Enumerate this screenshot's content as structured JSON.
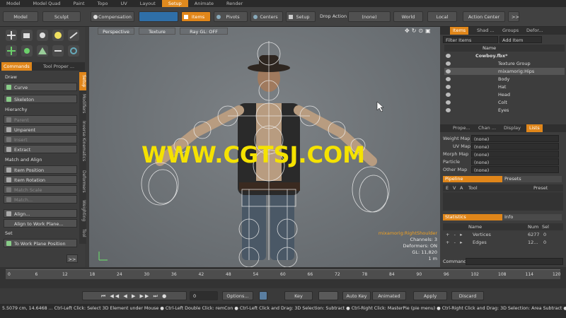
{
  "top_tabs": [
    "Model",
    "Model Quad",
    "Paint",
    "Topo",
    "UV",
    "Layout",
    "Setup",
    "Animate",
    "Render"
  ],
  "active_top_tab": "Setup",
  "toolbar": {
    "model": "Model",
    "sculpt": "Sculpt",
    "compensation": "Compensation",
    "items": "Items",
    "pivots": "Pivots",
    "centers": "Centers",
    "setup": "Setup",
    "drop_action_label": "Drop Action",
    "drop_action_value": "(none)",
    "world": "World",
    "local": "Local",
    "action_center": "Action Center",
    "more": ">>"
  },
  "left_tabs": {
    "commands": "Commands",
    "tool_properties": "Tool Proper ..."
  },
  "left_sections": {
    "draw": "Draw",
    "curve": "Curve",
    "skeleton": "Skeleton",
    "hierarchy": "Hierarchy",
    "parent": "Parent",
    "unparent": "Unparent",
    "insert": "Insert",
    "extract": "Extract",
    "match_align": "Match and Align",
    "item_position": "Item Position",
    "item_rotation": "Item Rotation",
    "match_scale": "Match Scale",
    "match": "Match...",
    "align": "Align...",
    "align_work_plane": "Align to Work Plane...",
    "set": "Set",
    "to_work_plane": "To Work Plane Position",
    "more": ">>"
  },
  "vertical_tabs": [
    "Setup",
    "Modifiers",
    "Inverse Kinematics",
    "Deformers",
    "Weighting",
    "Tool"
  ],
  "viewport": {
    "perspective": "Perspective",
    "texture": "Texture",
    "ray_gl": "Ray GL: OFF",
    "watermark": "WWW.CGTSJ.COM",
    "info_item": "mixamorig:RightShoulder",
    "info_channels": "Channels: 3",
    "info_deformers": "Deformers: ON",
    "info_gl": "GL: 11,820",
    "info_scale": "1 m"
  },
  "items_panel": {
    "tabs": [
      "Items",
      "Shad ...",
      "Groups",
      "Defor..."
    ],
    "filter": "Filter Items",
    "add_item": "Add Item",
    "name_header": "Name",
    "rows": [
      "Cowboy.fbx*",
      "Texture Group",
      "mixamorig:Hips",
      "Body",
      "Hat",
      "Head",
      "Colt",
      "Eyes"
    ]
  },
  "props_panel": {
    "tabs": [
      "Prope...",
      "Chan ...",
      "Display",
      "Lists"
    ],
    "rows": [
      {
        "label": "Weight Map",
        "value": "(none)"
      },
      {
        "label": "UV Map",
        "value": "(none)"
      },
      {
        "label": "Morph Map",
        "value": "(none)"
      },
      {
        "label": "Particle",
        "value": "(none)"
      },
      {
        "label": "Other Map",
        "value": "(none)"
      }
    ]
  },
  "pipeline": {
    "tab": "Pipeline",
    "presets": "Presets",
    "headers": [
      "E",
      "V",
      "A",
      "Tool",
      "Preset"
    ]
  },
  "statistics": {
    "tab": "Statistics",
    "info": "Info",
    "headers": [
      "Name",
      "Num",
      "Sel"
    ],
    "rows": [
      {
        "name": "Vertices",
        "num": "6277",
        "sel": "0"
      },
      {
        "name": "Edges",
        "num": "12...",
        "sel": "0"
      }
    ]
  },
  "command_label": "Command",
  "timeline_ticks": [
    "0",
    "6",
    "12",
    "18",
    "24",
    "30",
    "36",
    "42",
    "48",
    "54",
    "60",
    "66",
    "72",
    "78",
    "84",
    "90",
    "96",
    "102",
    "108",
    "114",
    "120"
  ],
  "bottom": {
    "frame": "0",
    "options": "Options...",
    "key": "Key",
    "auto_key": "Auto Key",
    "animated": "Animated",
    "apply": "Apply",
    "discard": "Discard"
  },
  "status_text": "5.5079 cm, 14.6468 ...   Ctrl-Left Click: Select 3D Element under Mouse  ● Ctrl-Left Double Click: remCon  ● Ctrl-Left Click and Drag: 3D Selection: Subtract  ● Ctrl-Right Click: MasterPie (pie menu)  ● Ctrl-Right Click and Drag: 3D Selection: Area Subtract  ● Ctrl-..."
}
